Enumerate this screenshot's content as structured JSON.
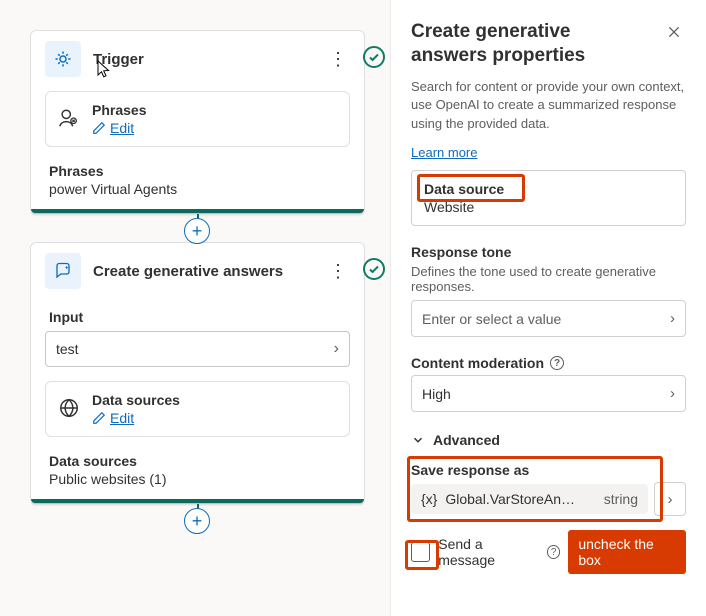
{
  "canvas": {
    "trigger": {
      "title": "Trigger",
      "phrases_label": "Phrases",
      "edit": "Edit",
      "footer_label": "Phrases",
      "footer_value": "power Virtual Agents"
    },
    "gen": {
      "title": "Create generative answers",
      "input_label": "Input",
      "input_value": "test",
      "ds_label": "Data sources",
      "edit": "Edit",
      "footer_label": "Data sources",
      "footer_value": "Public websites (1)"
    }
  },
  "panel": {
    "title": "Create generative answers properties",
    "desc": "Search for content or provide your own context, use OpenAI to create a summarized response using the provided data.",
    "learn": "Learn more",
    "data_source_label": "Data source",
    "data_source_value": "Website",
    "tone_label": "Response tone",
    "tone_desc": "Defines the tone used to create generative responses.",
    "tone_placeholder": "Enter or select a value",
    "moderation_label": "Content moderation",
    "moderation_value": "High",
    "advanced": "Advanced",
    "save_as_label": "Save response as",
    "var_name": "Global.VarStoreAn…",
    "var_type": "string",
    "send_msg": "Send a message",
    "annotation": "uncheck the box"
  }
}
